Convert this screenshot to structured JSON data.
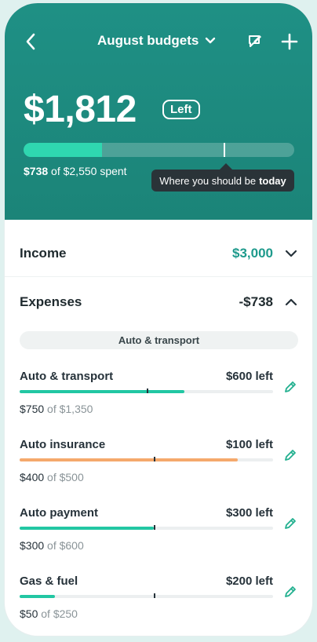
{
  "header": {
    "title": "August budgets",
    "amount_left": "$1,812",
    "left_label": "Left",
    "spent_amount": "$738",
    "spent_of": "of $2,550 spent",
    "progress_fraction": 0.29,
    "today_fraction": 0.74,
    "tooltip_text": "Where you should be",
    "tooltip_bold": "today"
  },
  "income": {
    "label": "Income",
    "value": "$3,000",
    "color": "#1e9a8c"
  },
  "expenses": {
    "label": "Expenses",
    "value": "-$738"
  },
  "group_label": "Auto & transport",
  "colors": {
    "header_bg": "#1f9085",
    "accent": "#2fd7b0",
    "teal_bar": "#22c7a3",
    "orange_bar": "#f5a96c"
  },
  "categories": [
    {
      "name": "Auto & transport",
      "left": "$600 left",
      "spent": "$750",
      "of": "of $1,350",
      "fraction": 0.65,
      "today": 0.5,
      "color": "#22c7a3"
    },
    {
      "name": "Auto insurance",
      "left": "$100 left",
      "spent": "$400",
      "of": "of $500",
      "fraction": 0.86,
      "today": 0.53,
      "color": "#f5a96c"
    },
    {
      "name": "Auto payment",
      "left": "$300 left",
      "spent": "$300",
      "of": "of $600",
      "fraction": 0.53,
      "today": 0.53,
      "color": "#22c7a3"
    },
    {
      "name": "Gas & fuel",
      "left": "$200 left",
      "spent": "$50",
      "of": "of $250",
      "fraction": 0.14,
      "today": 0.53,
      "color": "#22c7a3"
    }
  ]
}
